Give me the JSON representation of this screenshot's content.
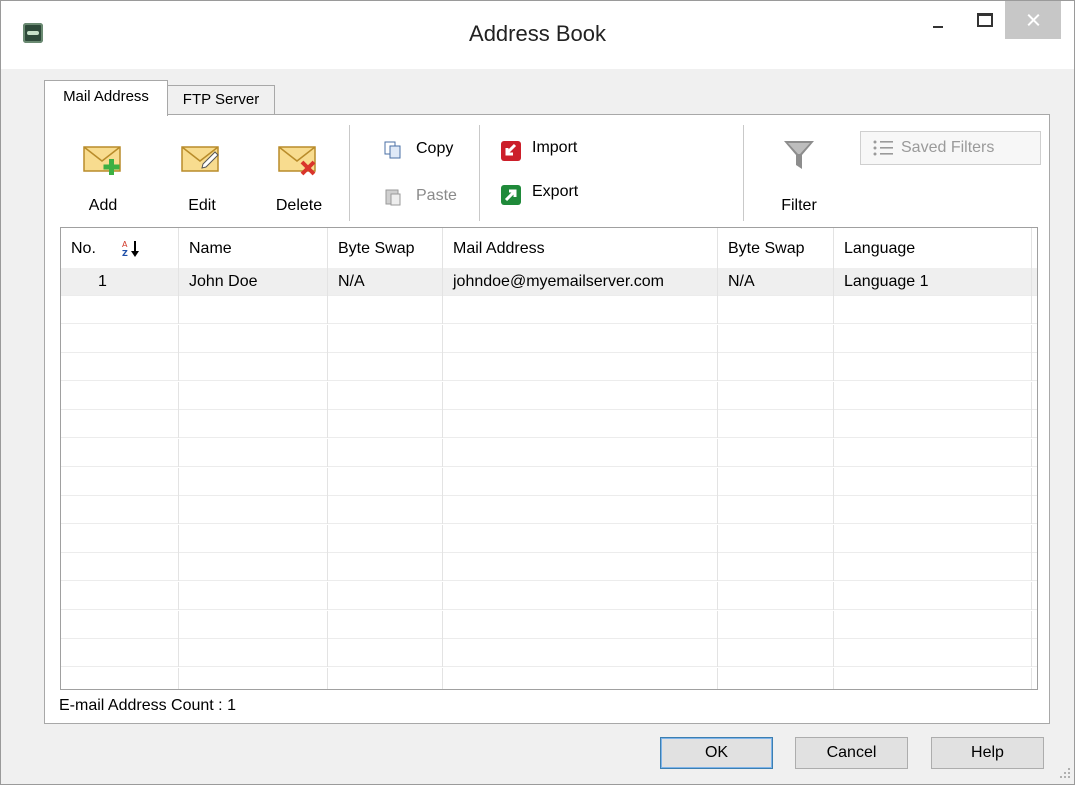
{
  "window": {
    "title": "Address Book",
    "app_icon": "app-logo-icon",
    "controls": [
      "minimize-icon",
      "maximize-icon",
      "close-icon"
    ]
  },
  "tabs": [
    {
      "label": "Mail Address",
      "active": true
    },
    {
      "label": "FTP Server",
      "active": false
    }
  ],
  "toolbar": {
    "add": "Add",
    "edit": "Edit",
    "delete": "Delete",
    "copy": "Copy",
    "paste": "Paste",
    "import": "Import",
    "export": "Export",
    "filter": "Filter",
    "saved_filters": "Saved Filters"
  },
  "table": {
    "columns": [
      "No.",
      "Name",
      "Byte Swap",
      "Mail Address",
      "Byte Swap",
      "Language"
    ],
    "sort_icon": "sort-az-icon",
    "rows": [
      {
        "no": "1",
        "name": "John Doe",
        "byte_swap_1": "N/A",
        "mail": "johndoe@myemailserver.com",
        "byte_swap_2": "N/A",
        "language": "Language 1"
      }
    ]
  },
  "status": {
    "count_text": "E-mail Address Count : 1"
  },
  "buttons": {
    "ok": "OK",
    "cancel": "Cancel",
    "help": "Help"
  },
  "colors": {
    "import_red": "#cc1f2a",
    "export_green": "#1f8a3a",
    "envelope": "#f5d88a",
    "add_green": "#3cb043",
    "delete_red": "#d9342b"
  }
}
